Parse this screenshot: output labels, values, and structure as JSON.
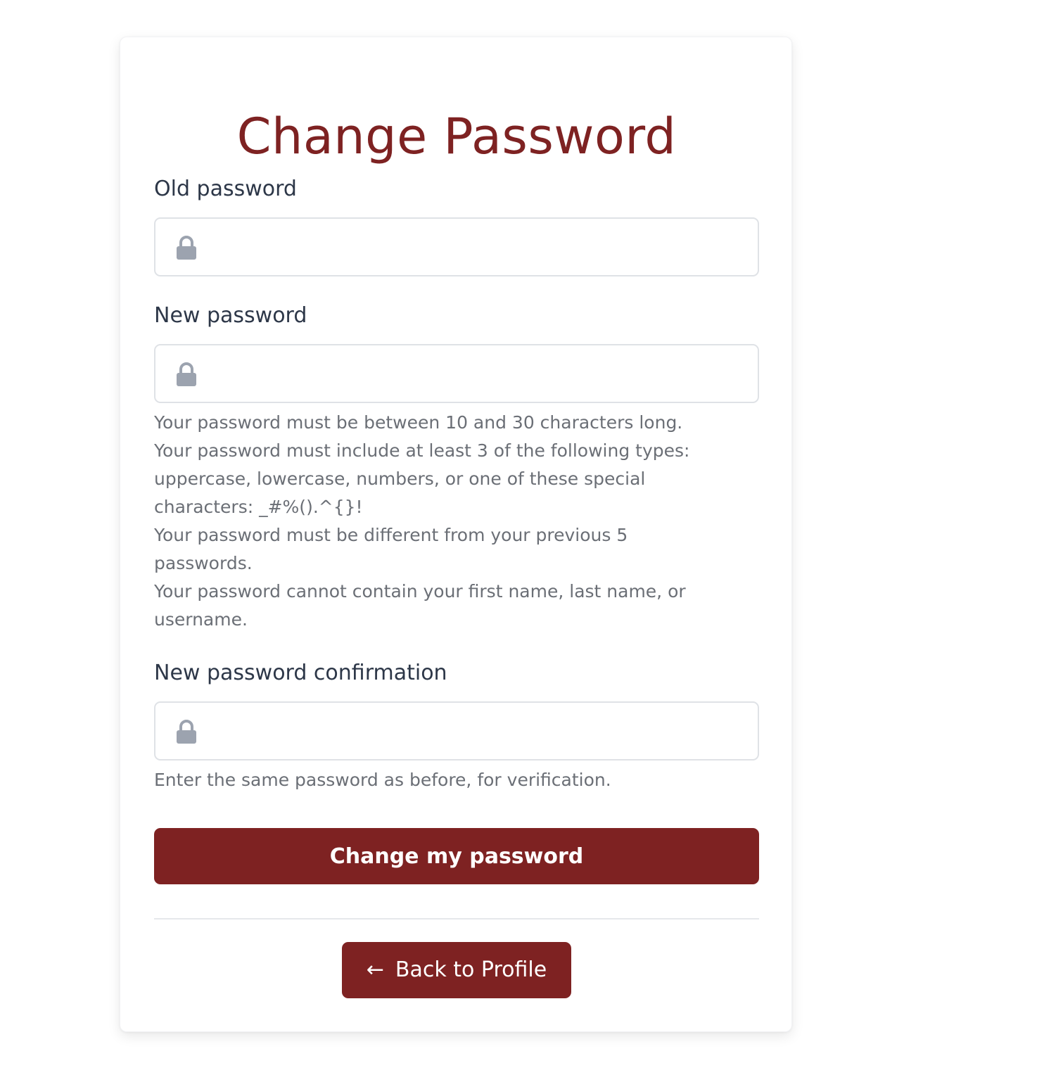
{
  "page": {
    "title": "Change Password"
  },
  "colors": {
    "accent": "#7e2222",
    "label": "#2d3748",
    "help_text": "#6b6f76",
    "icon": "#9ca3af"
  },
  "form": {
    "old_password": {
      "label": "Old password",
      "value": "",
      "icon": "lock-icon"
    },
    "new_password": {
      "label": "New password",
      "value": "",
      "icon": "lock-icon",
      "help": [
        "Your password must be between 10 and 30 characters long.",
        "Your password must include at least 3 of the following types:",
        "uppercase, lowercase, numbers, or one of these special",
        "characters: _#%().^{}!",
        "Your password must be different from your previous 5",
        "passwords.",
        "Your password cannot contain your first name, last name, or",
        "username."
      ]
    },
    "confirm_password": {
      "label": "New password confirmation",
      "value": "",
      "icon": "lock-icon",
      "help": "Enter the same password as before, for verification."
    },
    "submit_label": "Change my password"
  },
  "back_link": {
    "icon": "arrow-left-icon",
    "label": "Back to Profile"
  }
}
